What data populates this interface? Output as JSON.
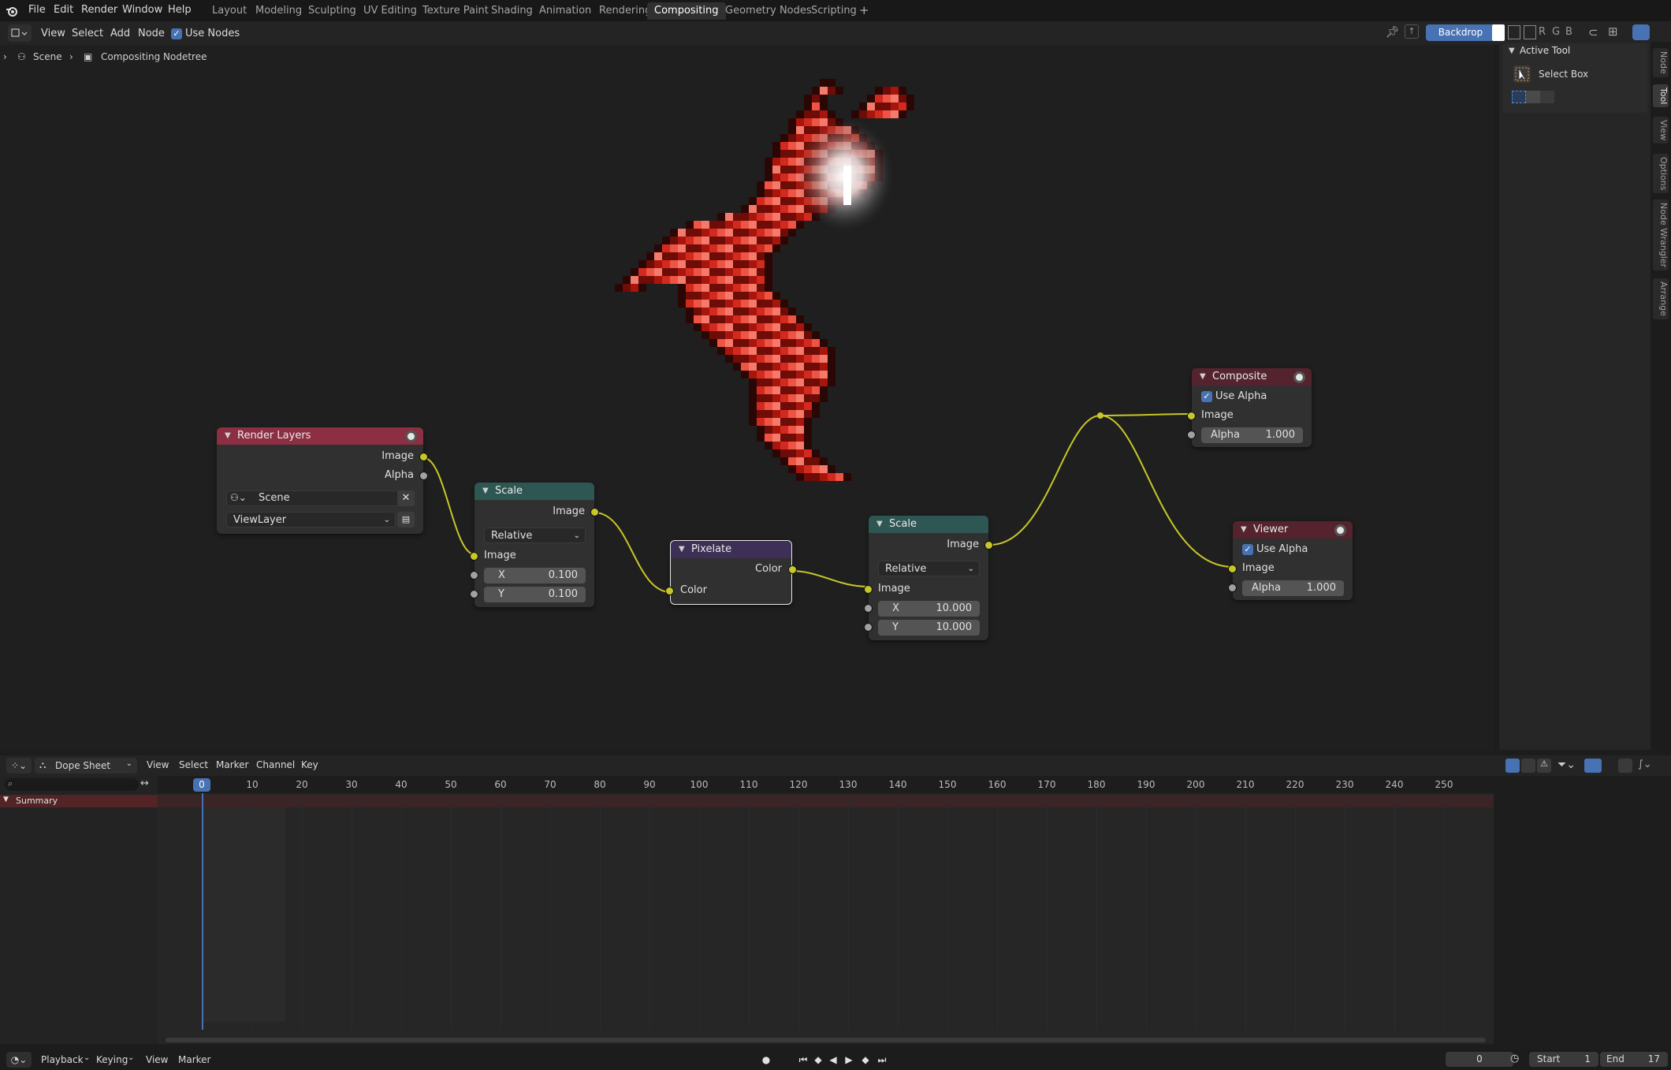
{
  "menu": {
    "file": "File",
    "edit": "Edit",
    "render": "Render",
    "window": "Window",
    "help": "Help"
  },
  "workspaces": [
    "Layout",
    "Modeling",
    "Sculpting",
    "UV Editing",
    "Texture Paint",
    "Shading",
    "Animation",
    "Rendering",
    "Compositing",
    "Geometry Nodes",
    "Scripting"
  ],
  "active_workspace": "Compositing",
  "editor_header": {
    "view": "View",
    "select": "Select",
    "add": "Add",
    "node": "Node",
    "use_nodes": "Use Nodes",
    "backdrop": "Backdrop",
    "channels": [
      "R",
      "G",
      "B"
    ]
  },
  "breadcrumb": {
    "scene": "Scene",
    "tree": "Compositing Nodetree"
  },
  "sidebar": {
    "panel_title": "Active Tool",
    "tool_name": "Select Box",
    "tabs": [
      "Node",
      "Tool",
      "View",
      "Options",
      "Node Wrangler",
      "Arrange"
    ],
    "active_tab": "Tool"
  },
  "nodes": {
    "render_layers": {
      "title": "Render Layers",
      "out_image": "Image",
      "out_alpha": "Alpha",
      "scene": "Scene",
      "view_layer": "ViewLayer"
    },
    "scale1": {
      "title": "Scale",
      "out_image": "Image",
      "space": "Relative",
      "in_image": "Image",
      "x_label": "X",
      "x": "0.100",
      "y_label": "Y",
      "y": "0.100"
    },
    "pixelate": {
      "title": "Pixelate",
      "out_color": "Color",
      "in_color": "Color"
    },
    "scale2": {
      "title": "Scale",
      "out_image": "Image",
      "space": "Relative",
      "in_image": "Image",
      "x_label": "X",
      "x": "10.000",
      "y_label": "Y",
      "y": "10.000"
    },
    "composite": {
      "title": "Composite",
      "use_alpha": "Use Alpha",
      "in_image": "Image",
      "alpha_label": "Alpha",
      "alpha": "1.000"
    },
    "viewer": {
      "title": "Viewer",
      "use_alpha": "Use Alpha",
      "in_image": "Image",
      "alpha_label": "Alpha",
      "alpha": "1.000"
    }
  },
  "colors": {
    "render_layers_head": "#8c2f43",
    "scale_head": "#2e5753",
    "pixelate_head": "#3d2f55",
    "output_head": "#54232e",
    "link": "#c7c729",
    "accent": "#4772b3",
    "pixel_red": "#d32a1f"
  },
  "dopesheet": {
    "editor": "Dope Sheet",
    "menus": [
      "View",
      "Select",
      "Marker",
      "Channel",
      "Key"
    ],
    "summary": "Summary",
    "current_frame_badge": "0",
    "ruler": [
      "10",
      "20",
      "30",
      "40",
      "50",
      "60",
      "70",
      "80",
      "90",
      "100",
      "110",
      "120",
      "130",
      "140",
      "150",
      "160",
      "170",
      "180",
      "190",
      "200",
      "210",
      "220",
      "230",
      "240",
      "250"
    ]
  },
  "statusbar": {
    "playback": "Playback",
    "keying": "Keying",
    "view": "View",
    "marker": "Marker",
    "current_frame": "0",
    "start_label": "Start",
    "start": "1",
    "end_label": "End",
    "end": "17"
  }
}
